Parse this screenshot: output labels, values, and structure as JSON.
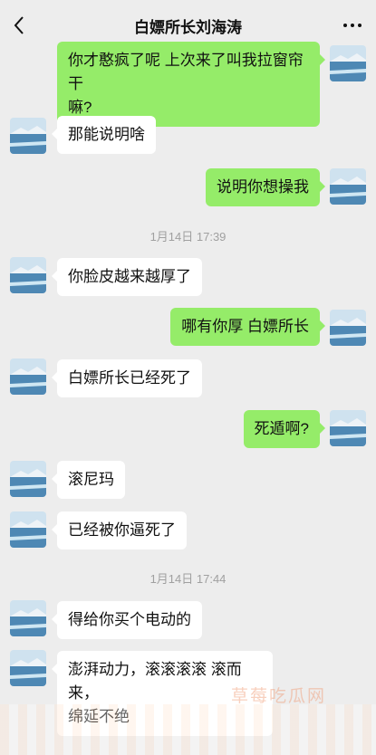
{
  "header": {
    "title": "白嫖所长刘海涛",
    "back_icon": "chevron-left-icon",
    "more_icon": "more-dots-icon"
  },
  "colors": {
    "background": "#ededed",
    "sent_bubble": "#95ec69",
    "received_bubble": "#ffffff",
    "timestamp": "#a0a0a0"
  },
  "messages": [
    {
      "side": "right",
      "text": "你才�becue疯了呢 上次来了叫我拉窗帘干\n嘛?"
    },
    {
      "side": "left",
      "text": "那能说明啥"
    },
    {
      "side": "right",
      "text": "说明你想操我"
    },
    {
      "type": "time",
      "text": "1月14日 17:39"
    },
    {
      "side": "left",
      "text": "你脸皮越来越厚了"
    },
    {
      "side": "right",
      "text": "哪有你厚 白嫖所长"
    },
    {
      "side": "left",
      "text": "白嫖所长已经死了"
    },
    {
      "side": "right",
      "text": "死遁啊?"
    },
    {
      "side": "left",
      "text": "滚尼玛"
    },
    {
      "side": "left",
      "text": "已经被你逼死了"
    },
    {
      "type": "time",
      "text": "1月14日 17:44"
    },
    {
      "side": "left",
      "text": "得给你买个电动的"
    },
    {
      "side": "left",
      "text": "澎湃动力，滚滚滚滚 滚而来，\n绵延不绝"
    }
  ],
  "watermark": "草莓吃瓜网"
}
